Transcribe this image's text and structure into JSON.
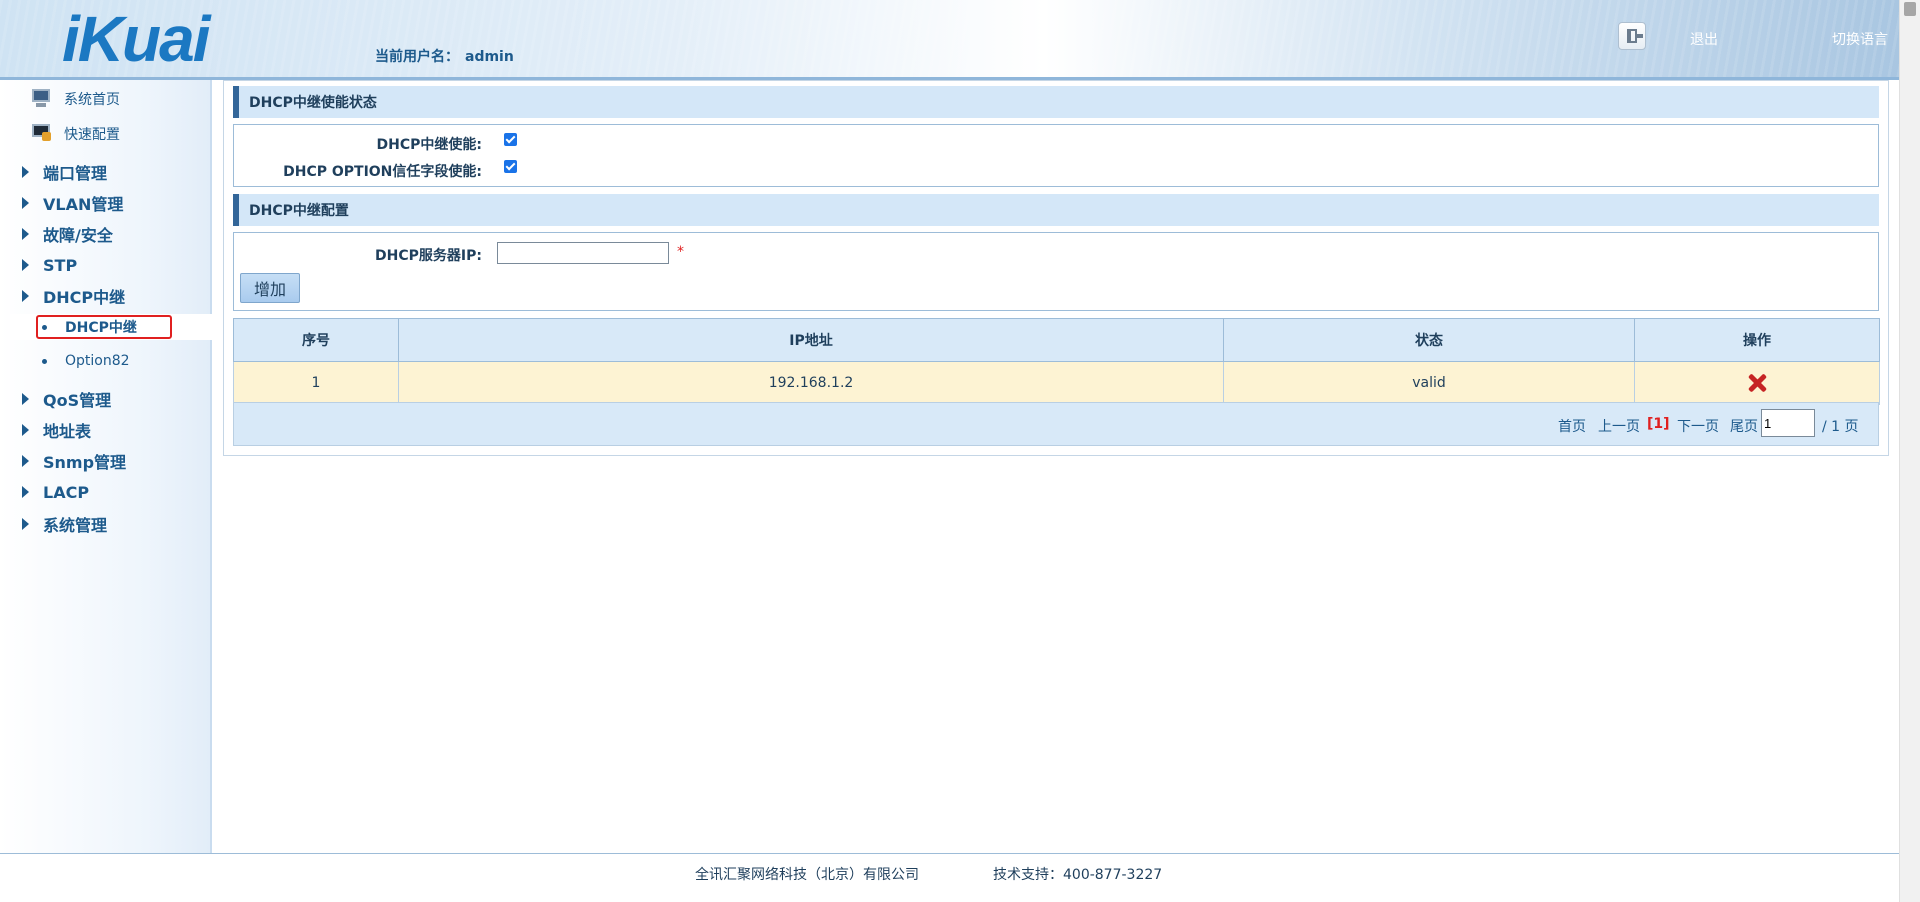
{
  "header": {
    "logo": "iKuai",
    "current_user_label": "当前用户名：",
    "current_user": "admin",
    "logout": "退出",
    "switch_language": "切换语言"
  },
  "sidebar": {
    "quick": [
      {
        "label": "系统首页",
        "icon": "home-computer-icon"
      },
      {
        "label": "快速配置",
        "icon": "quick-config-icon"
      }
    ],
    "groups": [
      {
        "label": "端口管理"
      },
      {
        "label": "VLAN管理"
      },
      {
        "label": "故障/安全"
      },
      {
        "label": "STP"
      },
      {
        "label": "DHCP中继",
        "expanded": true,
        "children": [
          {
            "label": "DHCP中继",
            "active": true
          },
          {
            "label": "Option82"
          }
        ]
      },
      {
        "label": "QoS管理"
      },
      {
        "label": "地址表"
      },
      {
        "label": "Snmp管理"
      },
      {
        "label": "LACP"
      },
      {
        "label": "系统管理"
      }
    ]
  },
  "status_section": {
    "title": "DHCP中继使能状态",
    "relay_enable_label": "DHCP中继使能:",
    "relay_enable_checked": true,
    "option_trust_label": "DHCP OPTION信任字段使能:",
    "option_trust_checked": true
  },
  "config_section": {
    "title": "DHCP中继配置",
    "server_ip_label": "DHCP服务器IP:",
    "server_ip_value": "",
    "required_mark": "*",
    "add_button": "增加"
  },
  "table": {
    "columns": [
      "序号",
      "IP地址",
      "状态",
      "操作"
    ],
    "rows": [
      {
        "index": "1",
        "ip": "192.168.1.2",
        "status": "valid",
        "action_icon": "delete-x-icon"
      }
    ]
  },
  "pager": {
    "first": "首页",
    "prev": "上一页",
    "current": "[1]",
    "next": "下一页",
    "last": "尾页",
    "page_input": "1",
    "total": "/ 1 页"
  },
  "footer": {
    "company": "全讯汇聚网络科技（北京）有限公司",
    "support": "技术支持：400-877-3227"
  },
  "colors": {
    "brand": "#1b78c2",
    "section_header_bg": "#d4e7f8",
    "row_bg": "#fdf3d3",
    "highlight_border": "#e02020",
    "delete_icon": "#c62424"
  }
}
